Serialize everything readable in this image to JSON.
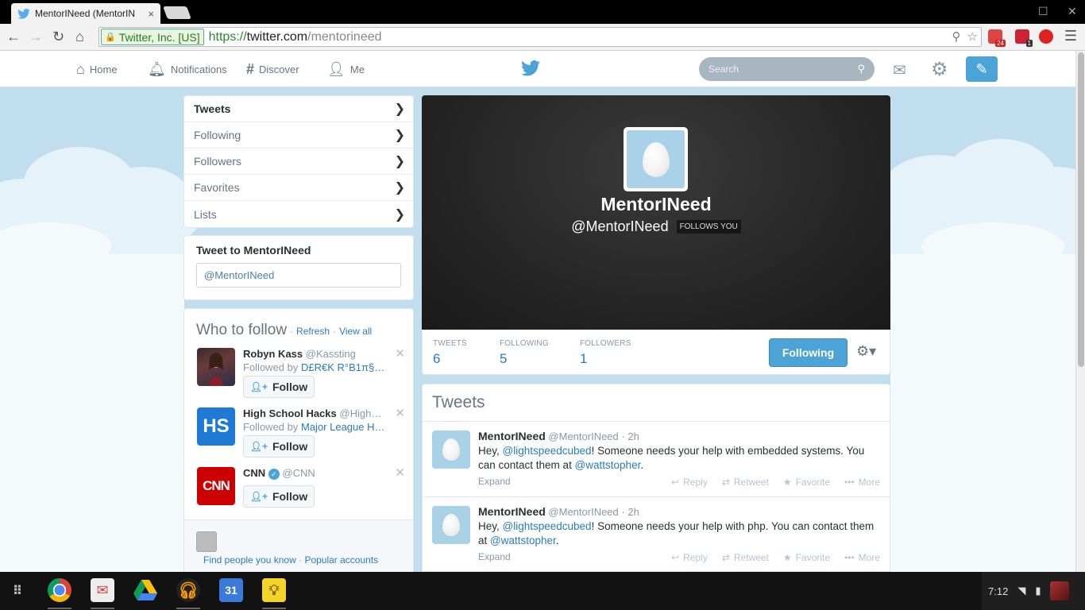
{
  "browser": {
    "tab_title": "MentorINeed (MentorIN",
    "tab_close": "×",
    "ev_label": "Twitter, Inc. [US]",
    "url_scheme": "https://",
    "url_host": "twitter.com",
    "url_path": "/mentorineed",
    "ext_badge_1": "24",
    "ext_badge_2": "1"
  },
  "topnav": {
    "home": "Home",
    "notifications": "Notifications",
    "discover": "Discover",
    "me": "Me",
    "search_placeholder": "Search"
  },
  "nav_list": {
    "items": [
      {
        "label": "Tweets"
      },
      {
        "label": "Following"
      },
      {
        "label": "Followers"
      },
      {
        "label": "Favorites"
      },
      {
        "label": "Lists"
      }
    ]
  },
  "tweet_to": {
    "title": "Tweet to MentorINeed",
    "value": "@MentorINeed"
  },
  "who_to_follow": {
    "title": "Who to follow",
    "refresh": "Refresh",
    "view_all": "View all",
    "dot": "·",
    "suggestions": [
      {
        "name": "Robyn Kass",
        "handle": "@Kassting",
        "followed_by_prefix": "Followed by",
        "followed_by": "D£R€K R°B1π§…",
        "follow_label": "Follow"
      },
      {
        "name": "High School Hacks",
        "handle": "@High…",
        "followed_by_prefix": "Followed by",
        "followed_by": "Major League H…",
        "follow_label": "Follow",
        "avatar_text": "HS"
      },
      {
        "name": "CNN",
        "handle": "@CNN",
        "follow_label": "Follow",
        "avatar_text": "CNN"
      }
    ],
    "find_people": "Find people you know",
    "popular": "Popular accounts"
  },
  "profile": {
    "name": "MentorINeed",
    "handle": "@MentorINeed",
    "follows_you": "FOLLOWS YOU",
    "stats": [
      {
        "label": "TWEETS",
        "value": "6"
      },
      {
        "label": "FOLLOWING",
        "value": "5"
      },
      {
        "label": "FOLLOWERS",
        "value": "1"
      }
    ],
    "following_button": "Following"
  },
  "stream": {
    "title": "Tweets",
    "tweets": [
      {
        "name": "MentorINeed",
        "handle": "@MentorINeed",
        "time": "· 2h",
        "text_1": "Hey, ",
        "mention_1": "@lightspeedcubed",
        "text_2": "! Someone needs your help with embedded systems. You can contact them at ",
        "mention_2": "@wattstopher",
        "text_3": "."
      },
      {
        "name": "MentorINeed",
        "handle": "@MentorINeed",
        "time": "· 2h",
        "text_1": "Hey, ",
        "mention_1": "@lightspeedcubed",
        "text_2": "! Someone needs your help with php. You can contact them at ",
        "mention_2": "@wattstopher",
        "text_3": "."
      }
    ],
    "expand": "Expand",
    "actions": {
      "reply": "Reply",
      "retweet": "Retweet",
      "favorite": "Favorite",
      "more": "More"
    }
  },
  "shelf": {
    "calendar_day": "31",
    "clock": "7:12"
  },
  "colors": {
    "twitter_blue": "#4ba3d6",
    "link": "#2b7bb9",
    "sky": "#c0deed"
  }
}
